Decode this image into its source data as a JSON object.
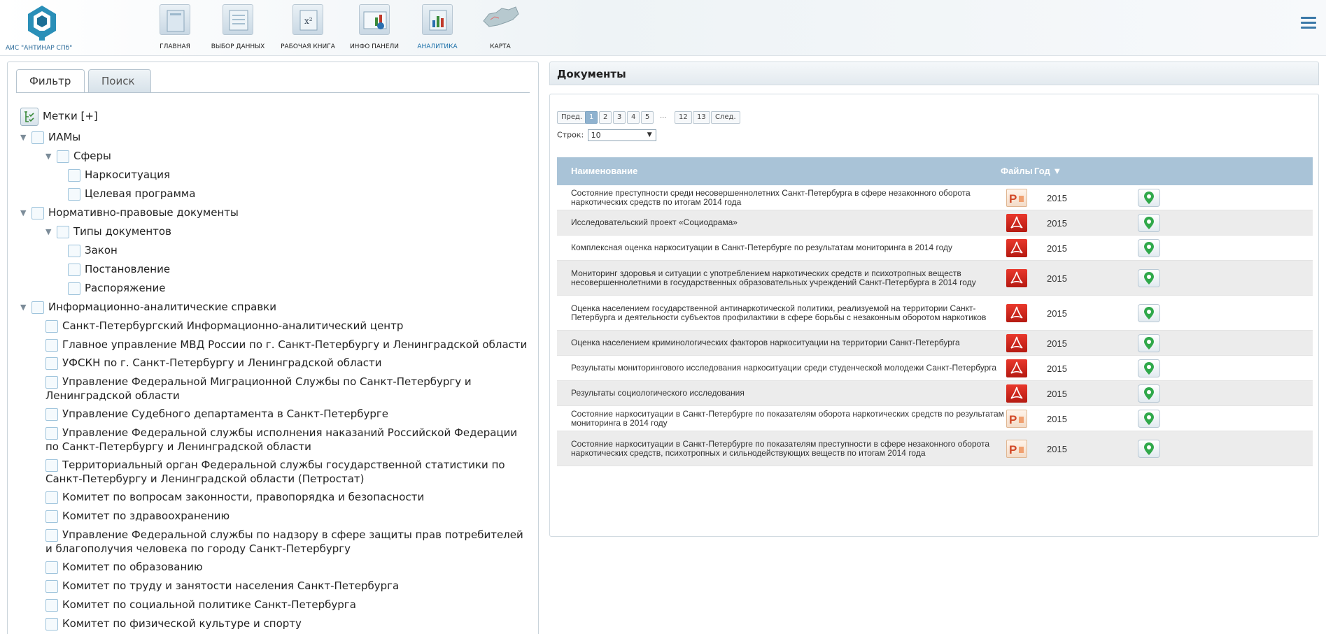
{
  "header": {
    "logo_text": "АИС \"АНТИНАР СПб\"",
    "nav": [
      {
        "label": "ГЛАВНАЯ",
        "icon": "home-icon"
      },
      {
        "label": "ВЫБОР ДАННЫХ",
        "icon": "data-select-icon"
      },
      {
        "label": "РАБОЧАЯ КНИГА",
        "icon": "workbook-icon"
      },
      {
        "label": "ИНФО ПАНЕЛИ",
        "icon": "dashboard-icon"
      },
      {
        "label": "АНАЛИТИКА",
        "icon": "analytics-icon",
        "active": true
      },
      {
        "label": "КАРТА",
        "icon": "map-icon"
      }
    ],
    "menu_icon": "hamburger-icon"
  },
  "left": {
    "tabs": [
      "Фильтр",
      "Поиск"
    ],
    "active_tab": "Фильтр",
    "tags_label": "Метки [+]",
    "tree": [
      {
        "label": "ИАМы"
      },
      {
        "label": "Сферы"
      },
      {
        "label": "Наркоситуация"
      },
      {
        "label": "Целевая программа"
      },
      {
        "label": "Нормативно-правовые документы"
      },
      {
        "label": "Типы документов"
      },
      {
        "label": "Закон"
      },
      {
        "label": "Постановление"
      },
      {
        "label": "Распоряжение"
      },
      {
        "label": "Информационно-аналитические справки"
      },
      {
        "label": "Санкт-Петербургский Информационно-аналитический центр"
      },
      {
        "label": "Главное управление МВД России по г. Санкт-Петербургу и Ленинградской области"
      },
      {
        "label": "УФСКН по г. Санкт-Петербургу и Ленинградской области"
      },
      {
        "label": "Управление Федеральной Миграционной Службы по Санкт-Петербургу и Ленинградской области"
      },
      {
        "label": "Управление Судебного департамента в Санкт-Петербурге"
      },
      {
        "label": "Управление Федеральной службы исполнения наказаний Российской Федерации по Санкт-Петербургу и Ленинградской области"
      },
      {
        "label": "Территориальный орган Федеральной службы государственной статистики по Санкт-Петербургу и Ленинградской области (Петростат)"
      },
      {
        "label": "Комитет по вопросам законности, правопорядка и безопасности"
      },
      {
        "label": "Комитет по здравоохранению"
      },
      {
        "label": "Управление Федеральной службы по надзору в сфере защиты прав потребителей и благополучия человека по городу Санкт-Петербургу"
      },
      {
        "label": "Комитет по образованию"
      },
      {
        "label": "Комитет по труду и занятости населения Санкт-Петербурга"
      },
      {
        "label": "Комитет по социальной политике Санкт-Петербурга"
      },
      {
        "label": "Комитет по физической культуре и спорту"
      }
    ]
  },
  "docs": {
    "title": "Документы",
    "pager": {
      "prev": "Пред.",
      "pages": [
        "1",
        "2",
        "3",
        "4",
        "5",
        "...",
        "12",
        "13"
      ],
      "current": "1",
      "next": "След."
    },
    "rows_label": "Строк:",
    "rows_value": "10",
    "columns": {
      "name": "Наименование",
      "files": "Файлы",
      "year": "Год ▼"
    },
    "rows": [
      {
        "name": "Состояние преступности среди несовершеннолетних Санкт-Петербурга в сфере незаконного оборота наркотических средств по итогам 2014 года",
        "file": "ppt-icon",
        "year": "2015"
      },
      {
        "name": "Исследовательский проект «Социодрама»",
        "file": "pdf-icon",
        "year": "2015"
      },
      {
        "name": "Комплексная оценка наркоситуации в Санкт-Петербурге по результатам мониторинга в 2014 году",
        "file": "pdf-icon",
        "year": "2015"
      },
      {
        "name": "Мониторинг здоровья и ситуации с употреблением наркотических средств и психотропных веществ несовершеннолетними в государственных образовательных учреждений Санкт-Петербурга в 2014 году",
        "file": "pdf-icon",
        "year": "2015"
      },
      {
        "name": "Оценка населением государственной антинаркотической политики, реализуемой на территории Санкт-Петербурга и деятельности субъектов профилактики в сфере борьбы с незаконным оборотом наркотиков",
        "file": "pdf-icon",
        "year": "2015"
      },
      {
        "name": "Оценка населением криминологических факторов наркоситуации на территории Санкт-Петербурга",
        "file": "pdf-icon",
        "year": "2015"
      },
      {
        "name": "Результаты мониторингового исследования наркоситуации среди студенческой молодежи Санкт-Петербурга",
        "file": "pdf-icon",
        "year": "2015"
      },
      {
        "name": "Результаты социологического исследования",
        "file": "pdf-icon",
        "year": "2015"
      },
      {
        "name": "Состояние наркоситуации в Санкт-Петербурге по показателям оборота наркотических средств по результатам мониторинга в 2014 году",
        "file": "ppt-icon",
        "year": "2015"
      },
      {
        "name": "Состояние наркоситуации в Санкт-Петербурге по показателям преступности в сфере незаконного оборота наркотических средств, психотропных и сильнодействующих веществ по итогам 2014 года",
        "file": "ppt-icon",
        "year": "2015"
      }
    ]
  },
  "colors": {
    "accent": "#1b6fa8",
    "table_header": "#a9c3d7",
    "checkbox_border": "#9fc4dc",
    "pdf_red": "#d0281e",
    "map_pin_green": "#2fa84a"
  }
}
